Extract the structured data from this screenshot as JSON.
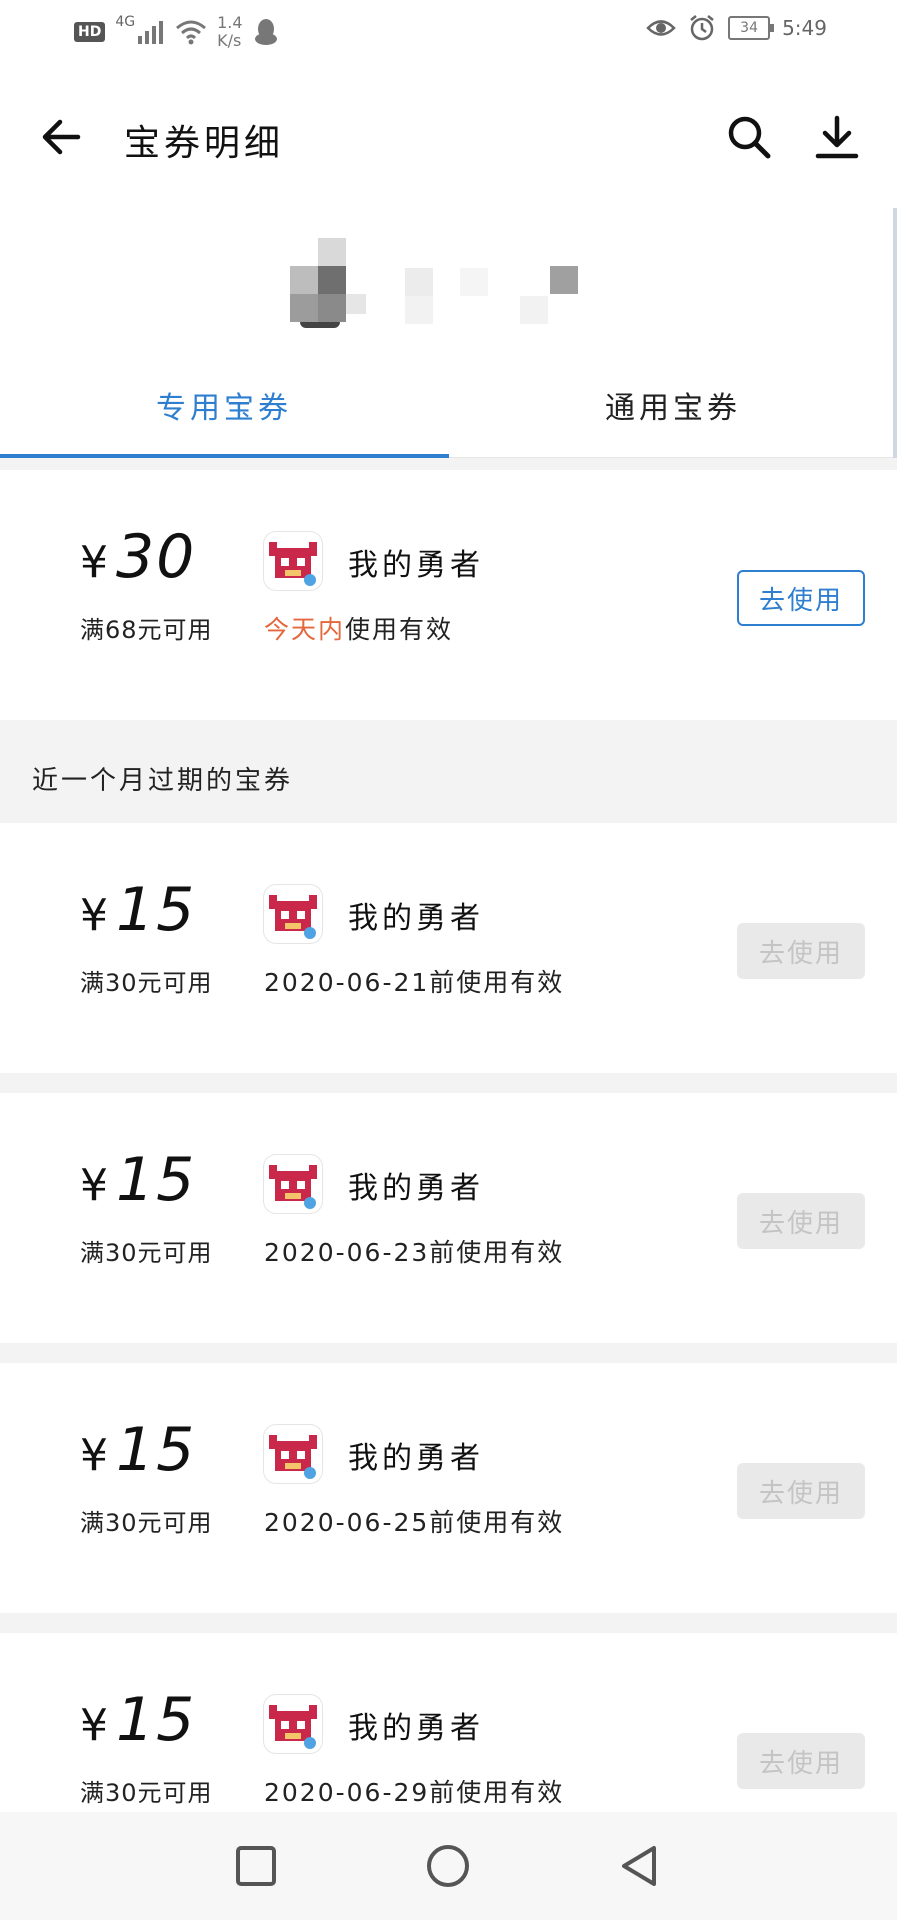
{
  "status_bar": {
    "hd": "HD",
    "network": "4G",
    "speed_value": "1.4",
    "speed_unit": "K/s",
    "battery": "34",
    "time": "5:49"
  },
  "header": {
    "title": "宝券明细"
  },
  "tabs": [
    {
      "label": "专用宝券",
      "active": true
    },
    {
      "label": "通用宝券",
      "active": false
    }
  ],
  "current_coupon": {
    "currency": "¥",
    "amount": "30",
    "condition": "满68元可用",
    "app_name": "我的勇者",
    "validity_highlight": "今天内",
    "validity_suffix": "使用有效",
    "button": "去使用"
  },
  "expired_section": {
    "title": "近一个月过期的宝券"
  },
  "expired_coupons": [
    {
      "currency": "¥",
      "amount": "15",
      "condition": "满30元可用",
      "app_name": "我的勇者",
      "validity": "2020-06-21前使用有效",
      "button": "去使用"
    },
    {
      "currency": "¥",
      "amount": "15",
      "condition": "满30元可用",
      "app_name": "我的勇者",
      "validity": "2020-06-23前使用有效",
      "button": "去使用"
    },
    {
      "currency": "¥",
      "amount": "15",
      "condition": "满30元可用",
      "app_name": "我的勇者",
      "validity": "2020-06-25前使用有效",
      "button": "去使用"
    },
    {
      "currency": "¥",
      "amount": "15",
      "condition": "满30元可用",
      "app_name": "我的勇者",
      "validity": "2020-06-29前使用有效",
      "button": "去使用"
    }
  ],
  "colors": {
    "accent": "#2f7fd0",
    "highlight": "#e4683c",
    "disabled_bg": "#e9e9e9",
    "disabled_text": "#c4c4c4"
  }
}
